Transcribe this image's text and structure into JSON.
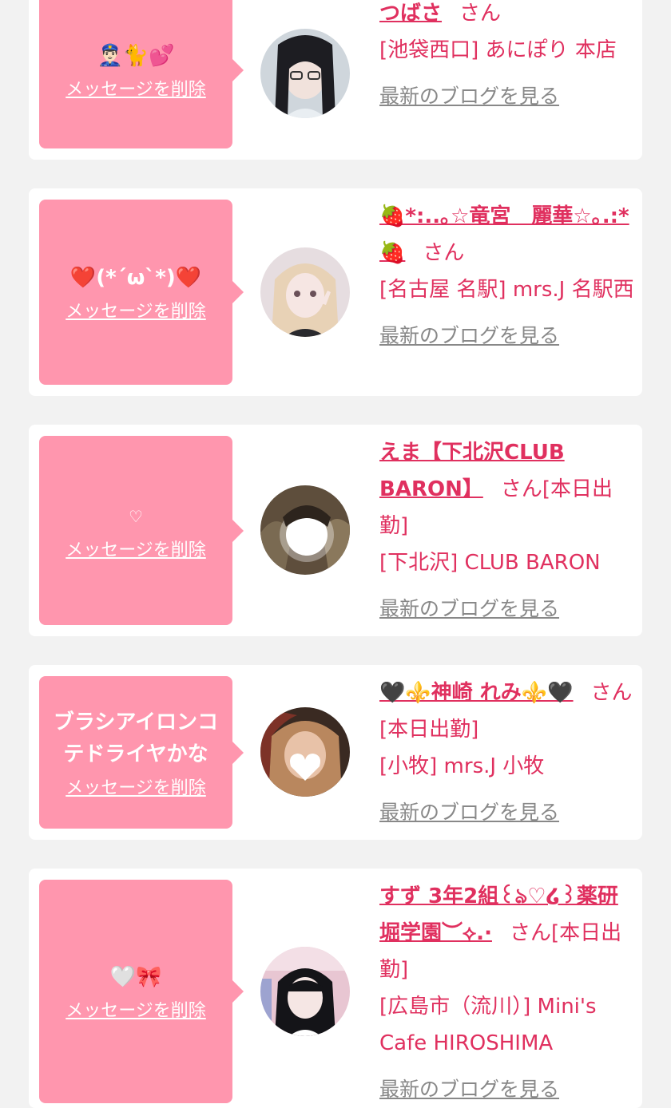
{
  "delete_label": "メッセージを削除",
  "blog_label": "最新のブログを見る",
  "san": "さん",
  "colors": {
    "bubble": "#ff96ae",
    "accent": "#e0305f",
    "link_gray": "#888888",
    "page_bg": "#f2f2f2"
  },
  "cards": [
    {
      "message": "👮🏻‍♂️🐈💕",
      "name": "つばさ",
      "status": "",
      "shop": "[池袋西口] あにぽり 本店"
    },
    {
      "message": "❤️(*´ω`*)❤️",
      "name": "🍓*:..｡☆竜宮　麗華☆｡.:*🍓",
      "status": "",
      "shop": "[名古屋 名駅] mrs.J 名駅西"
    },
    {
      "message": "♡",
      "name": "えま【下北沢CLUB BARON】",
      "status": "[本日出勤]",
      "shop": "[下北沢] CLUB BARON"
    },
    {
      "message": "ブラシアイロンコテドライヤかな",
      "name": "🖤⚜️神崎 れみ⚜️🖤",
      "status": "[本日出勤]",
      "shop": "[小牧] mrs.J 小牧"
    },
    {
      "message": "🤍🎀",
      "name": "すず 3年2組꒰ঌ♡໒꒱薬研堀学園︶⟡.·",
      "status": "[本日出勤]",
      "shop": "[広島市（流川）] Mini's Cafe HIROSHIMA"
    }
  ]
}
